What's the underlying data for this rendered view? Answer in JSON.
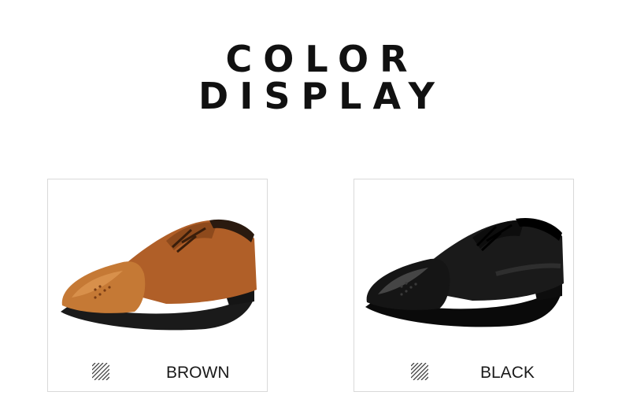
{
  "title": {
    "line1": "COLOR",
    "line2": "DISPLAY"
  },
  "variants": [
    {
      "label": "BROWN",
      "upper_color": "#b8652b",
      "toe_color": "#c47633",
      "sole_color": "#1a1a1a",
      "swatch_icon": "diagonal-stripes-icon"
    },
    {
      "label": "BLACK",
      "upper_color": "#1c1c1c",
      "toe_color": "#111111",
      "sole_color": "#0a0a0a",
      "swatch_icon": "diagonal-stripes-icon"
    }
  ]
}
